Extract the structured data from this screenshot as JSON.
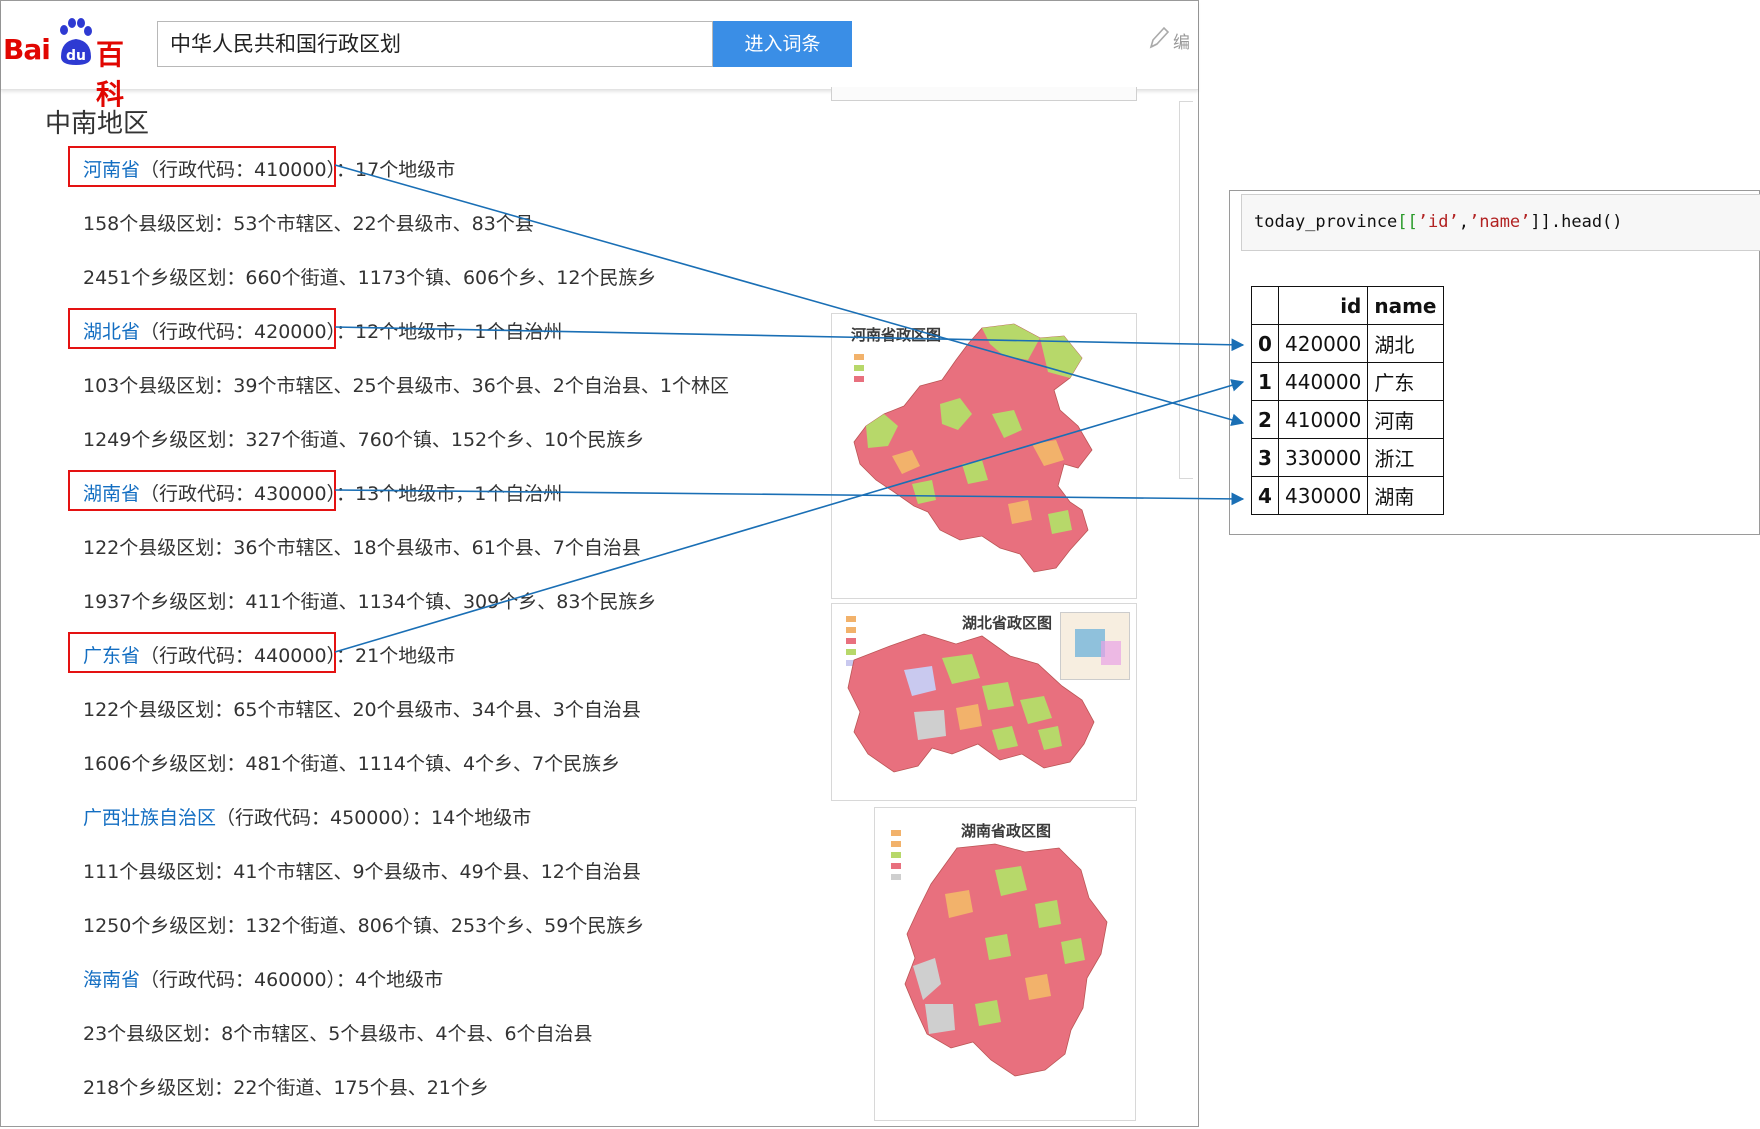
{
  "header": {
    "logo": {
      "bai": "Bai",
      "du": "du",
      "baike": "百科"
    },
    "search_value": "中华人民共和国行政区划",
    "search_button": "进入词条",
    "edit_label": "编"
  },
  "section_title": "中南地区",
  "provinces": [
    {
      "name": "河南省",
      "code_text": "（行政代码：410000）",
      "suffix": "：17个地级市",
      "counties": "158个县级区划：53个市辖区、22个县级市、83个县",
      "towns": "2451个乡级区划：660个街道、1173个镇、606个乡、12个民族乡"
    },
    {
      "name": "湖北省",
      "code_text": "（行政代码：420000）",
      "suffix": "：12个地级市，1个自治州",
      "counties": "103个县级区划：39个市辖区、25个县级市、36个县、2个自治县、1个林区",
      "towns": "1249个乡级区划：327个街道、760个镇、152个乡、10个民族乡"
    },
    {
      "name": "湖南省",
      "code_text": "（行政代码：430000）",
      "suffix": "：13个地级市，1个自治州",
      "counties": "122个县级区划：36个市辖区、18个县级市、61个县、7个自治县",
      "towns": "1937个乡级区划：411个街道、1134个镇、309个乡、83个民族乡"
    },
    {
      "name": "广东省",
      "code_text": "（行政代码：440000）",
      "suffix": "：21个地级市",
      "counties": "122个县级区划：65个市辖区、20个县级市、34个县、3个自治县",
      "towns": "1606个乡级区划：481个街道、1114个镇、4个乡、7个民族乡"
    },
    {
      "name": "广西壮族自治区",
      "code_text": "（行政代码：450000）",
      "suffix": "：14个地级市",
      "counties": "111个县级区划：41个市辖区、9个县级市、49个县、12个自治县",
      "towns": "1250个乡级区划：132个街道、806个镇、253个乡、59个民族乡"
    },
    {
      "name": "海南省",
      "code_text": "（行政代码：460000）",
      "suffix": "：4个地级市",
      "counties": "23个县级区划：8个市辖区、5个县级市、4个县、6个自治县",
      "towns": "218个乡级区划：22个街道、175个县、21个乡"
    }
  ],
  "maps": {
    "henan_title": "河南省政区图",
    "hubei_title": "湖北省政区图",
    "hunan_title": "湖南省政区图"
  },
  "colors": {
    "map_red": "#e8707e",
    "map_green": "#b7d86a",
    "map_orange": "#f2b26b",
    "link": "#136ec2",
    "arrow": "#1a6fb5",
    "box": "#e41212"
  },
  "notebook": {
    "code": {
      "fn": "today_province",
      "open": "[[",
      "s1": "’id’",
      "comma": ",",
      "s2": "’name’",
      "close": "]].head()"
    },
    "table": {
      "columns": [
        "id",
        "name"
      ],
      "rows": [
        {
          "index": "0",
          "id": "420000",
          "name": "湖北"
        },
        {
          "index": "1",
          "id": "440000",
          "name": "广东"
        },
        {
          "index": "2",
          "id": "410000",
          "name": "河南"
        },
        {
          "index": "3",
          "id": "330000",
          "name": "浙江"
        },
        {
          "index": "4",
          "id": "430000",
          "name": "湖南"
        }
      ]
    }
  }
}
